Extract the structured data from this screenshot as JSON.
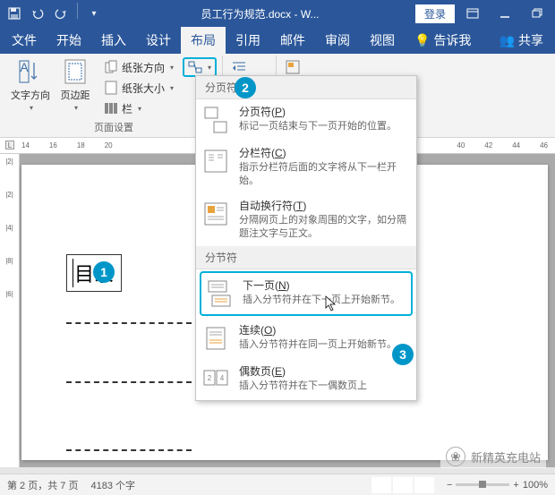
{
  "titlebar": {
    "doc_title": "员工行为规范.docx - W...",
    "login": "登录"
  },
  "menubar": {
    "tabs": [
      "文件",
      "开始",
      "插入",
      "设计",
      "布局",
      "引用",
      "邮件",
      "审阅",
      "视图"
    ],
    "active_index": 4,
    "tell_me": "告诉我",
    "share": "共享"
  },
  "ribbon": {
    "text_direction": "文字方向",
    "margins": "页边距",
    "orientation": "纸张方向",
    "size": "纸张大小",
    "columns": "栏",
    "group_label": "页面设置"
  },
  "ruler_h_left": [
    "14",
    "16",
    "18",
    "20"
  ],
  "ruler_h_right": [
    "40",
    "42",
    "44",
    "46"
  ],
  "ruler_v": [
    "|2|",
    "|2|",
    "|4|",
    "|8|",
    "|6|"
  ],
  "page": {
    "toc_label": "目录"
  },
  "dropdown": {
    "section1": "分页符",
    "section2": "分节符",
    "items1": [
      {
        "title_pre": "分页符(",
        "key": "P",
        "title_post": ")",
        "desc": "标记一页结束与下一页开始的位置。"
      },
      {
        "title_pre": "分栏符(",
        "key": "C",
        "title_post": ")",
        "desc": "指示分栏符后面的文字将从下一栏开始。"
      },
      {
        "title_pre": "自动换行符(",
        "key": "T",
        "title_post": ")",
        "desc": "分隔网页上的对象周围的文字，如分隔题注文字与正文。"
      }
    ],
    "items2": [
      {
        "title_pre": "下一页(",
        "key": "N",
        "title_post": ")",
        "desc": "插入分节符并在下一页上开始新节。",
        "hl": true
      },
      {
        "title_pre": "连续(",
        "key": "O",
        "title_post": ")",
        "desc": "插入分节符并在同一页上开始新节。"
      },
      {
        "title_pre": "偶数页(",
        "key": "E",
        "title_post": ")",
        "desc": "插入分节符并在下一偶数页上"
      }
    ]
  },
  "statusbar": {
    "page": "第 2 页，共 7 页",
    "words": "4183 个字",
    "zoom": "100%"
  },
  "callouts": {
    "c1": "1",
    "c2": "2",
    "c3": "3"
  },
  "watermark": "新精英充电站"
}
